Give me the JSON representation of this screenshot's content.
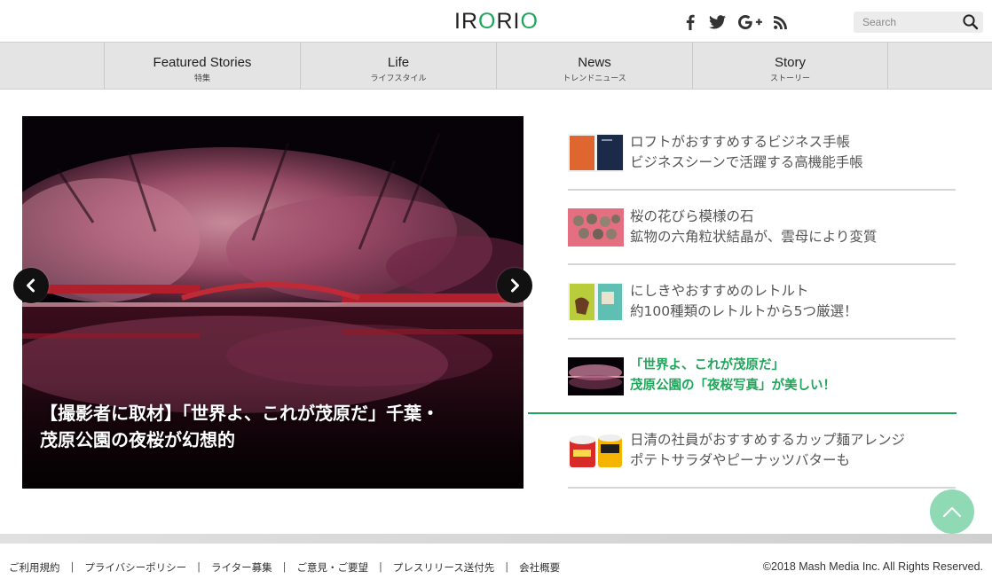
{
  "header": {
    "logo": {
      "part1": "IR",
      "part2": "O",
      "part3": "RI",
      "part4": "O"
    },
    "social": [
      {
        "icon": "facebook-icon"
      },
      {
        "icon": "twitter-icon"
      },
      {
        "icon": "google-plus-icon"
      },
      {
        "icon": "rss-icon"
      }
    ],
    "search": {
      "placeholder": "Search",
      "value": "",
      "icon": "search-icon"
    }
  },
  "nav": {
    "items": [
      {
        "en": "Featured Stories",
        "jp": "特集"
      },
      {
        "en": "Life",
        "jp": "ライフスタイル"
      },
      {
        "en": "News",
        "jp": "トレンドニュース"
      },
      {
        "en": "Story",
        "jp": "ストーリー"
      }
    ]
  },
  "hero": {
    "title_line1": "【撮影者に取材】「世界よ、これが茂原だ」千葉・",
    "title_line2": "茂原公園の夜桜が幻想的",
    "prev_icon": "chevron-left-icon",
    "next_icon": "chevron-right-icon"
  },
  "articles": [
    {
      "line1": "ロフトがおすすめするビジネス手帳",
      "line2": "ビジネスシーンで活躍する高機能手帳",
      "active": false
    },
    {
      "line1": "桜の花びら模様の石",
      "line2": "鉱物の六角粒状結晶が、雲母により変質",
      "active": false
    },
    {
      "line1": "にしきやおすすめのレトルト",
      "line2": "約100種類のレトルトから5つ厳選！",
      "active": false
    },
    {
      "line1": "「世界よ、これが茂原だ」",
      "line2": "茂原公園の「夜桜写真」が美しい！",
      "active": true
    },
    {
      "line1": "日清の社員がおすすめするカップ麺アレンジ",
      "line2": "ポテトサラダやピーナッツバターも",
      "active": false
    }
  ],
  "footer": {
    "links": [
      "ご利用規約",
      "プライバシーポリシー",
      "ライター募集",
      "ご意見・ご要望",
      "プレスリリース送付先",
      "会社概要"
    ],
    "separator": "|",
    "copyright": "©2018 Mash Media Inc. All Rights Reserved."
  },
  "colors": {
    "accent": "#1fa65a",
    "totop": "#8fd9b4",
    "nav_bg": "#e4e4e4"
  }
}
